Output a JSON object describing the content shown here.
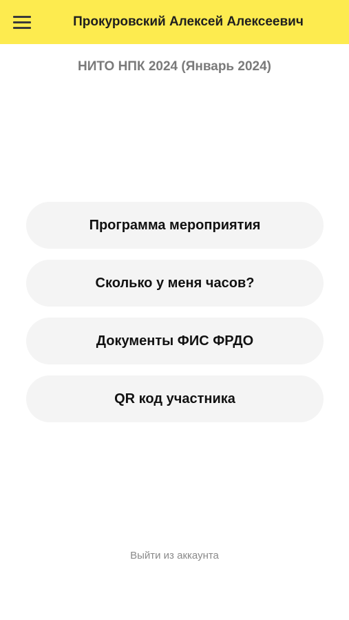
{
  "header": {
    "menu_icon": "hamburger-menu-icon",
    "user_name": "Прокуровский Алексей Алексеевич",
    "background_color": "#fdeb4f"
  },
  "event": {
    "title": "НИТО НПК 2024 (Январь 2024)"
  },
  "menu": {
    "items": [
      {
        "label": "Программа мероприятия"
      },
      {
        "label": "Сколько у меня часов?"
      },
      {
        "label": "Документы ФИС ФРДО"
      },
      {
        "label": "QR код участника"
      }
    ]
  },
  "footer": {
    "logout_label": "Выйти из аккаунта"
  }
}
